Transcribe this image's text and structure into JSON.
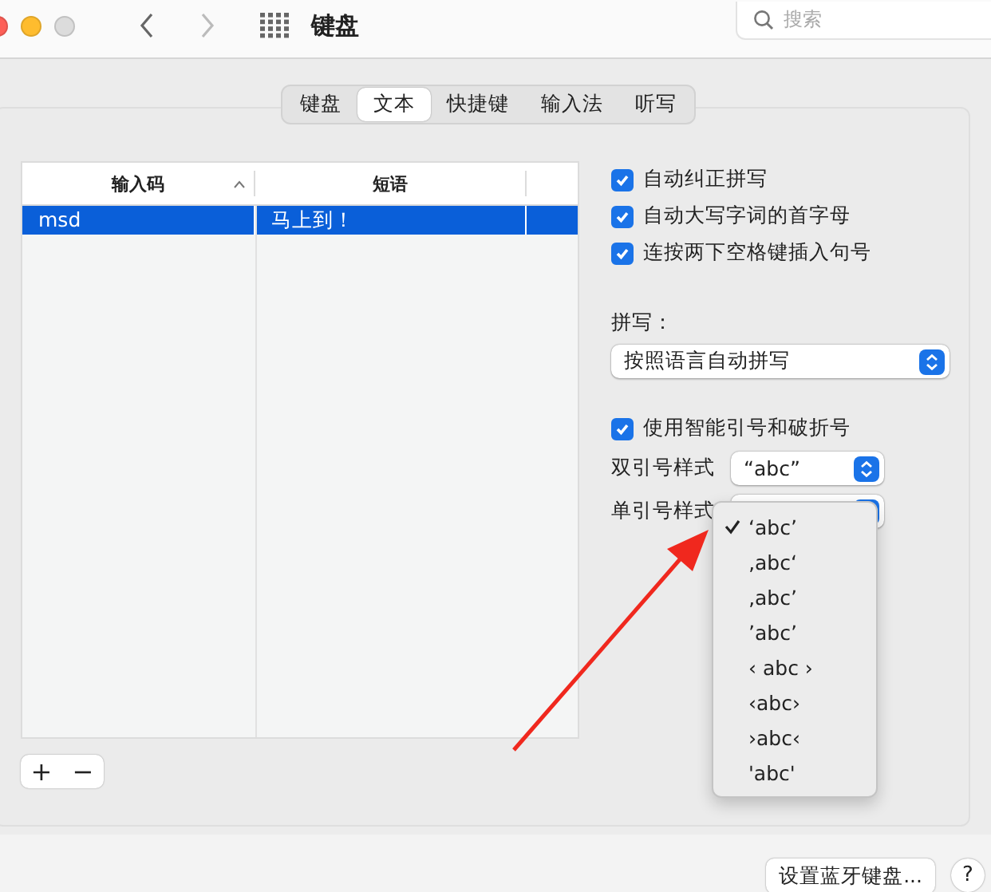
{
  "window": {
    "title": "键盘",
    "search_placeholder": "搜索"
  },
  "tabs": [
    {
      "label": "键盘",
      "selected": false
    },
    {
      "label": "文本",
      "selected": true
    },
    {
      "label": "快捷键",
      "selected": false
    },
    {
      "label": "输入法",
      "selected": false
    },
    {
      "label": "听写",
      "selected": false
    }
  ],
  "table": {
    "columns": [
      "输入码",
      "短语"
    ],
    "rows": [
      {
        "cells": [
          "msd",
          "马上到！"
        ],
        "selected": true
      }
    ]
  },
  "list_buttons": [
    "+",
    "−"
  ],
  "options": [
    {
      "label": "自动纠正拼写",
      "checked": true
    },
    {
      "label": "自动大写字词的首字母",
      "checked": true
    },
    {
      "label": "连按两下空格键插入句号",
      "checked": true
    }
  ],
  "spelling": {
    "label": "拼写：",
    "value": "按照语言自动拼写"
  },
  "smart_quotes": {
    "label": "使用智能引号和破折号",
    "checked": true
  },
  "double_quote": {
    "label": "双引号样式",
    "value": "“abc”"
  },
  "single_quote": {
    "label": "单引号样式",
    "menu": [
      {
        "label": "‘abc’",
        "selected": true
      },
      {
        "label": "‚abc‘",
        "selected": false
      },
      {
        "label": "‚abc’",
        "selected": false
      },
      {
        "label": "’abc’",
        "selected": false
      },
      {
        "label": "‹ abc ›",
        "selected": false
      },
      {
        "label": "‹abc›",
        "selected": false
      },
      {
        "label": "›abc‹",
        "selected": false
      },
      {
        "label": "'abc'",
        "selected": false
      }
    ]
  },
  "footer_button": "设置蓝牙键盘...",
  "help": "?"
}
